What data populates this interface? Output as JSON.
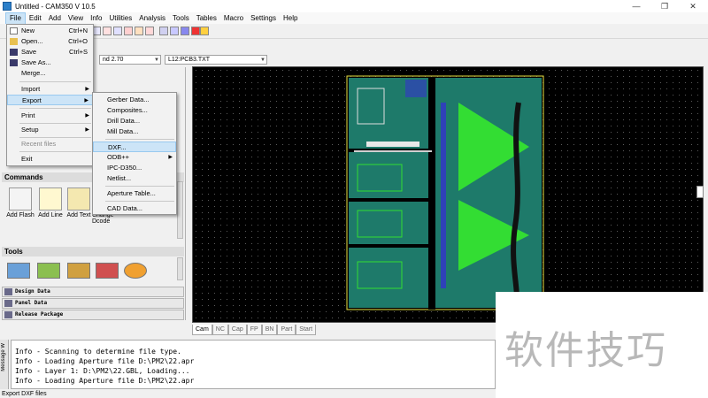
{
  "window": {
    "title": "Untitled - CAM350 V 10.5",
    "minimize": "—",
    "maximize": "❒",
    "close": "✕"
  },
  "menubar": [
    "File",
    "Edit",
    "Add",
    "View",
    "Info",
    "Utilities",
    "Analysis",
    "Tools",
    "Tables",
    "Macro",
    "Settings",
    "Help"
  ],
  "layerbar": {
    "layer_combo": "nd 2.70",
    "file_combo": "L12:PCB3.TXT"
  },
  "left_panel": {
    "commands_header": "Commands",
    "commands": [
      "Add Flash",
      "Add Line",
      "Add Text",
      "Change Dcode"
    ],
    "tools_header": "Tools",
    "nav": [
      "Design Data",
      "Panel Data",
      "Release Package"
    ]
  },
  "file_menu": {
    "items": [
      {
        "label": "New",
        "shortcut": "Ctrl+N"
      },
      {
        "label": "Open...",
        "shortcut": "Ctrl+O"
      },
      {
        "label": "Save",
        "shortcut": "Ctrl+S"
      },
      {
        "label": "Save As...",
        "shortcut": ""
      },
      {
        "label": "Merge...",
        "shortcut": ""
      },
      {
        "label": "Import",
        "shortcut": ""
      },
      {
        "label": "Export",
        "shortcut": ""
      },
      {
        "label": "Print",
        "shortcut": ""
      },
      {
        "label": "Setup",
        "shortcut": ""
      },
      {
        "label": "Recent files",
        "shortcut": ""
      },
      {
        "label": "Exit",
        "shortcut": ""
      }
    ]
  },
  "export_menu": {
    "items": [
      "Gerber Data...",
      "Composites...",
      "Drill Data...",
      "Mill Data...",
      "DXF...",
      "ODB++",
      "IPC-D350...",
      "Netlist...",
      "Aperture Table...",
      "CAD Data..."
    ]
  },
  "canvas_tabs": [
    "Cam",
    "NC",
    "Cap",
    "FP",
    "BN",
    "Part",
    "Start"
  ],
  "messages": {
    "side_label": "Message W",
    "lines": [
      "Info - Scanning to determine file type.",
      "Info - Loading Aperture file D:\\PM2\\22.apr",
      "Info - Layer 1: D:\\PM2\\22.GBL, Loading...",
      "Info - Loading Aperture file D:\\PM2\\22.apr"
    ]
  },
  "status": "Export DXF files",
  "watermark": "软件技巧",
  "colors": {
    "pcb_board": "#1e7a6a",
    "pcb_copper": "#33dd33",
    "pcb_outline": "#e8e040",
    "pcb_blue": "#3333cc",
    "menu_highlight": "#cce4f7"
  }
}
